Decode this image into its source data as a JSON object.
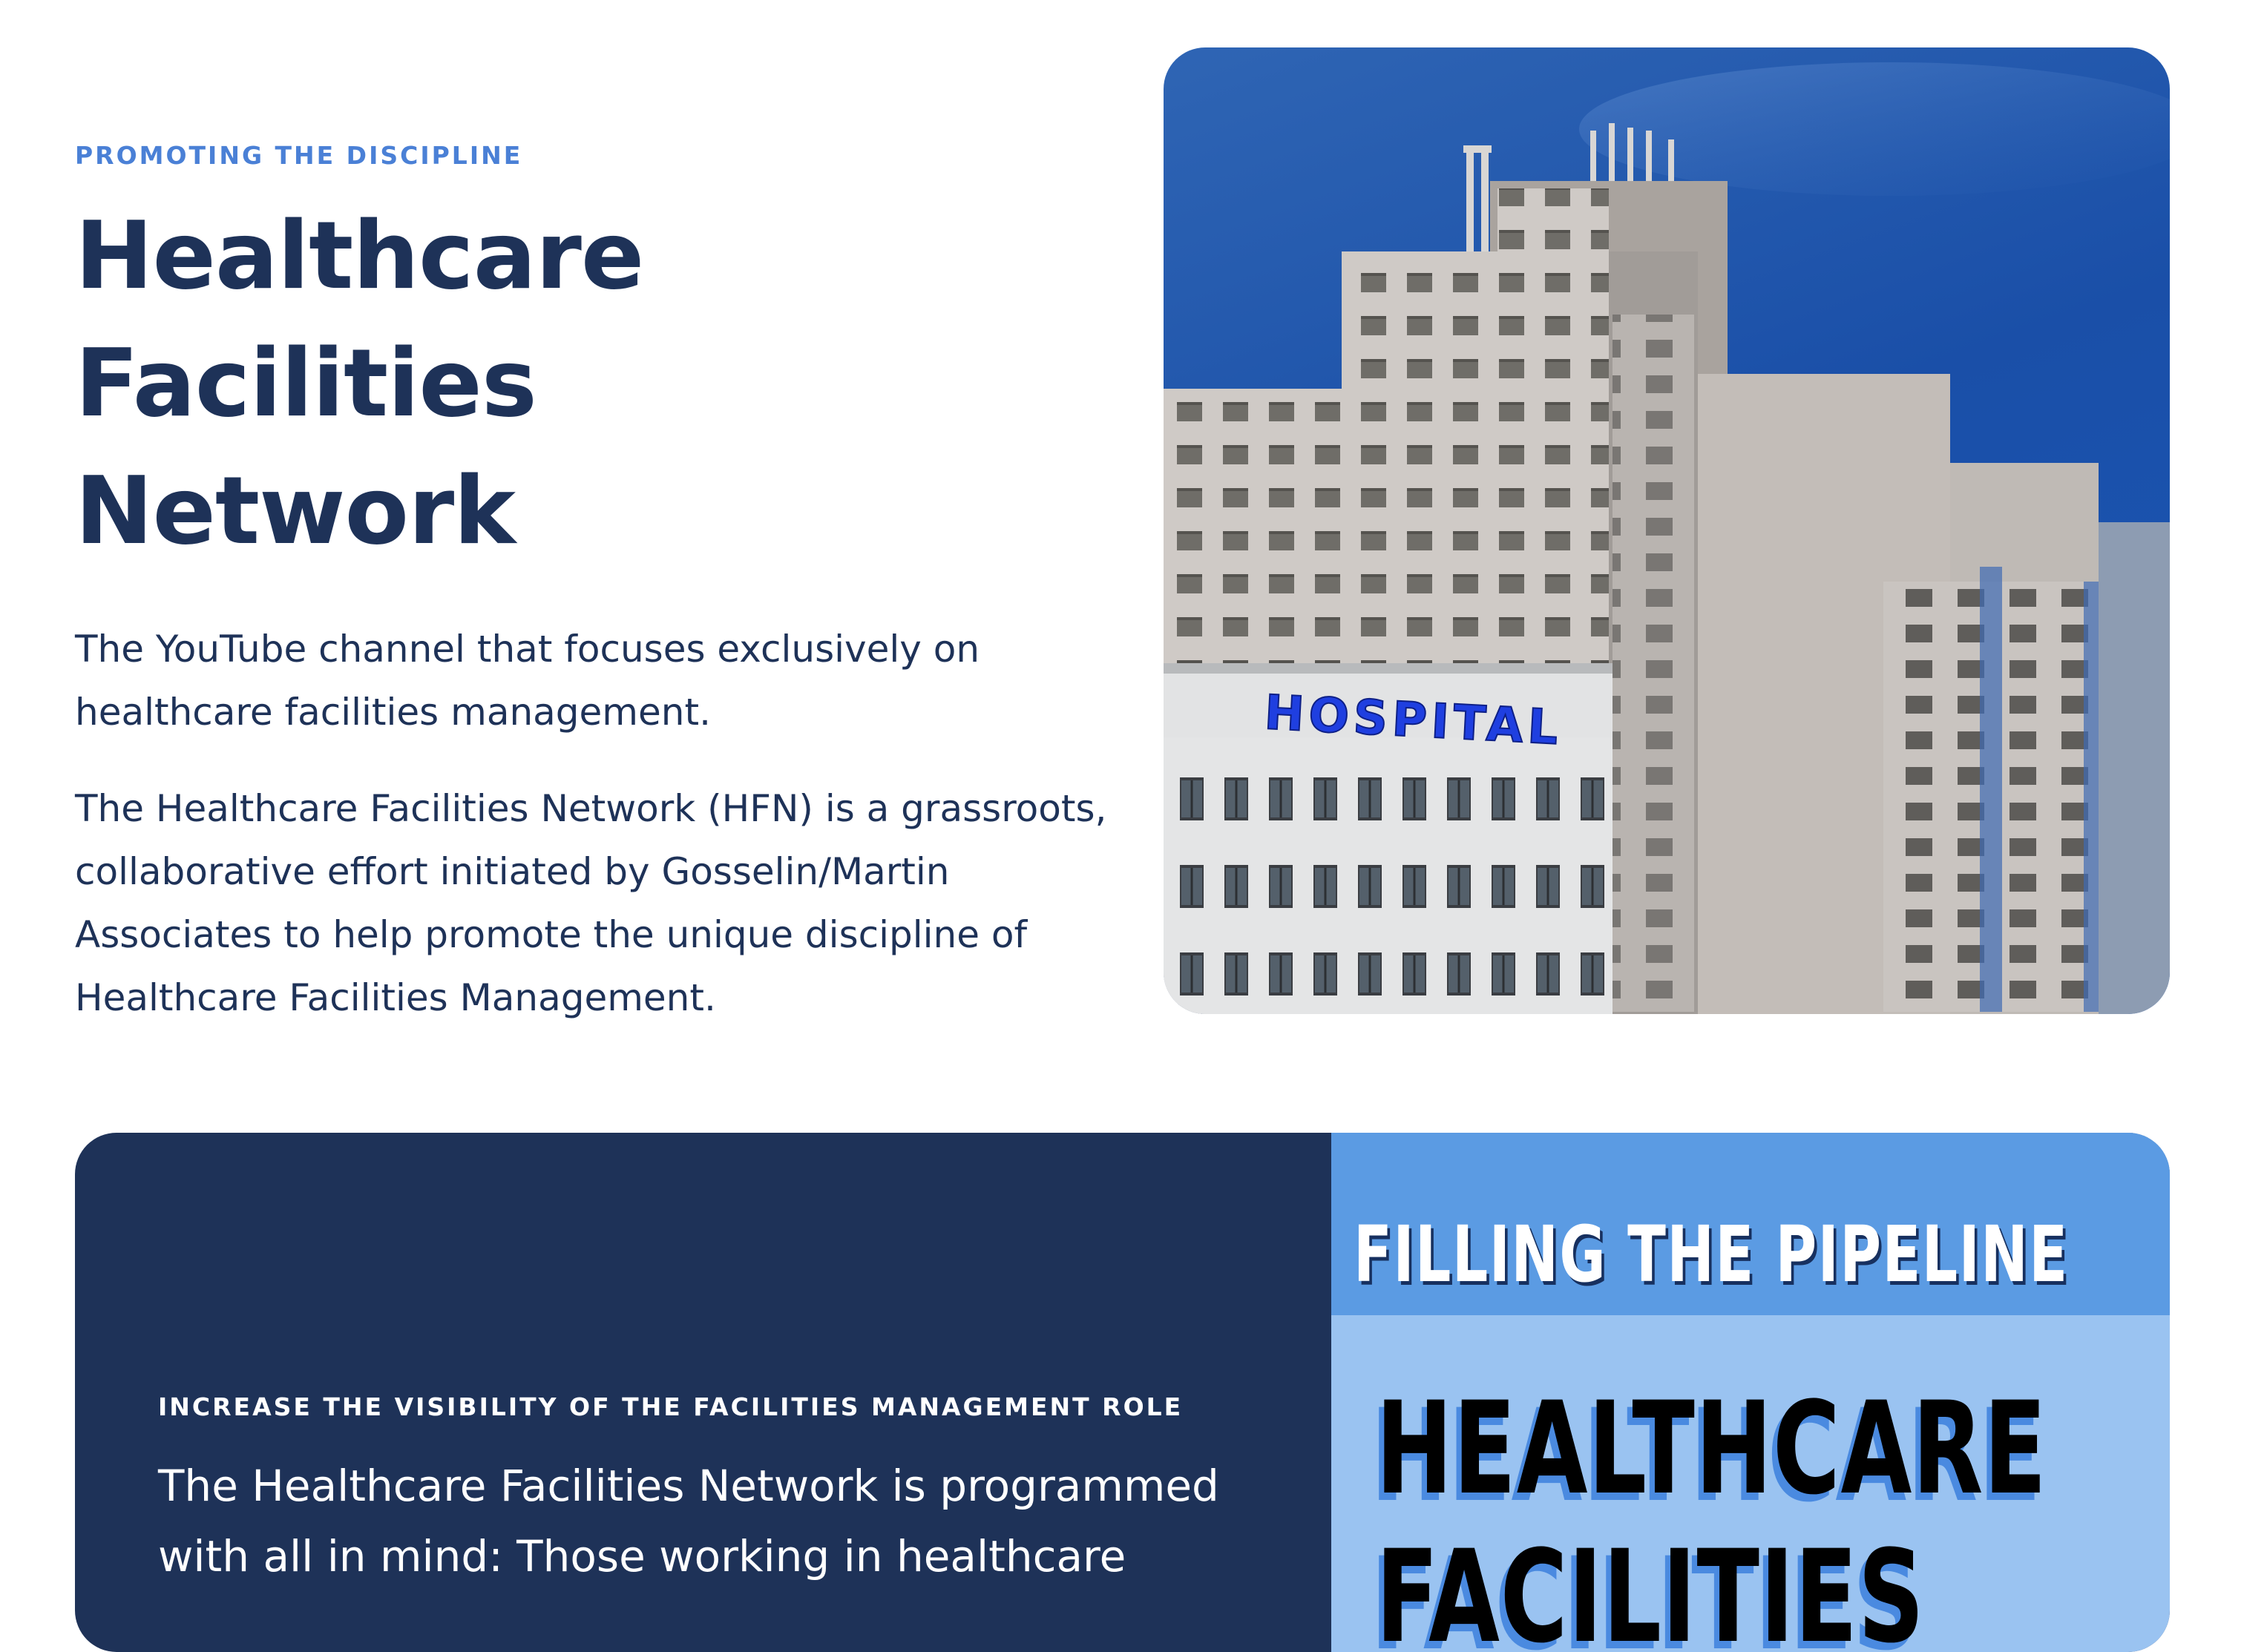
{
  "intro": {
    "eyebrow": "PROMOTING THE DISCIPLINE",
    "headline_line1": "Healthcare Facilities",
    "headline_line2": "Network",
    "lead": "The YouTube channel that focuses exclusively on healthcare facilities management.",
    "body": "The Healthcare Facilities Network (HFN) is a grassroots, collaborative effort initiated by Gosselin/Martin Associates to help promote the unique discipline of Healthcare Facilities Management."
  },
  "photo": {
    "sign_text": "HOSPITAL",
    "sky_color": "#1c58b8",
    "sign_color": "#1f3fe0"
  },
  "card": {
    "eyebrow": "INCREASE THE VISIBILITY OF THE FACILITIES MANAGEMENT ROLE",
    "body": "The Healthcare Facilities Network is programmed with all in mind: Those working in healthcare",
    "background_color": "#1e3258"
  },
  "poster": {
    "kicker": "FILLING THE PIPELINE",
    "title": "HEALTHCARE\nFACILITIES",
    "band_color": "#5b9be3",
    "background_color": "#9ac3f1"
  }
}
